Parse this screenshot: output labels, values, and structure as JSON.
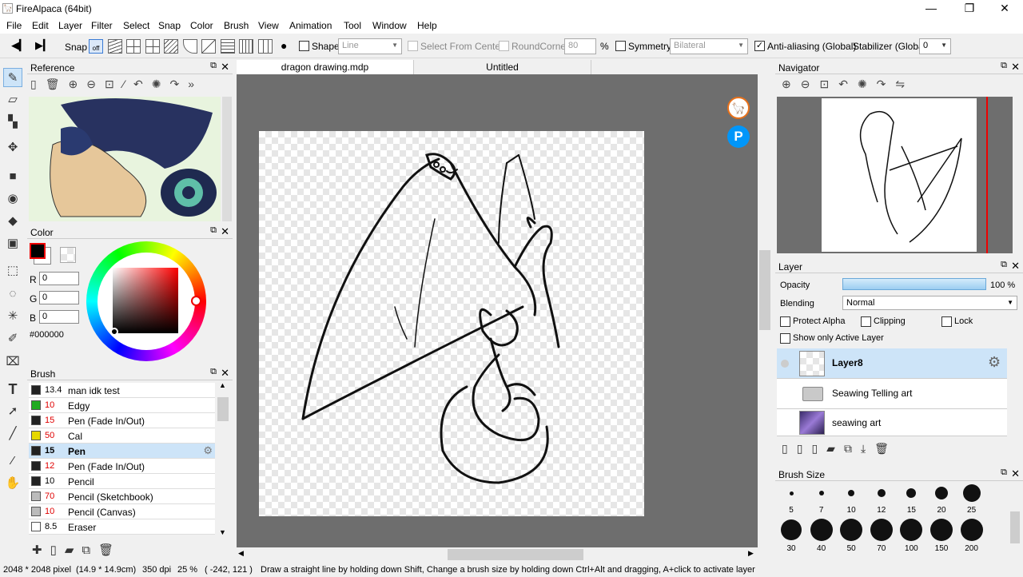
{
  "window": {
    "title": "FireAlpaca (64bit)",
    "min": "—",
    "max": "❐",
    "close": "✕"
  },
  "menu": [
    "File",
    "Edit",
    "Layer",
    "Filter",
    "Select",
    "Snap",
    "Color",
    "Brush",
    "View",
    "Animation",
    "Tool",
    "Window",
    "Help"
  ],
  "toolbar": {
    "snap_label": "Snap",
    "off_label": "off",
    "shape_label": "Shape",
    "shape_value": "Line",
    "select_from_center": "Select From Center",
    "roundcorner_label": "RoundCorner",
    "roundcorner_value": "80",
    "percent": "%",
    "symmetry_label": "Symmetry",
    "symmetry_value": "Bilateral",
    "antialias_label": "Anti-aliasing (Global)",
    "stabilizer_label": "Stabilizer (Global)",
    "stabilizer_value": "0"
  },
  "tabs": [
    {
      "label": "dragon drawing.mdp"
    },
    {
      "label": "Untitled"
    }
  ],
  "reference": {
    "title": "Reference"
  },
  "color": {
    "title": "Color",
    "r_label": "R",
    "g_label": "G",
    "b_label": "B",
    "r": "0",
    "g": "0",
    "b": "0",
    "hex": "#000000"
  },
  "brush": {
    "title": "Brush",
    "items": [
      {
        "size": "13.4",
        "name": "man idk test",
        "color": "#222222",
        "size_color": "#000"
      },
      {
        "size": "10",
        "name": "Edgy",
        "color": "#22aa22",
        "size_color": "#e00000"
      },
      {
        "size": "15",
        "name": "Pen (Fade In/Out)",
        "color": "#222222",
        "size_color": "#e00000"
      },
      {
        "size": "50",
        "name": "Cal",
        "color": "#e6d800",
        "size_color": "#e00000"
      },
      {
        "size": "15",
        "name": "Pen",
        "color": "#222222",
        "size_color": "#000"
      },
      {
        "size": "12",
        "name": "Pen (Fade In/Out)",
        "color": "#222222",
        "size_color": "#e00000"
      },
      {
        "size": "10",
        "name": "Pencil",
        "color": "#222222",
        "size_color": "#000"
      },
      {
        "size": "70",
        "name": "Pencil (Sketchbook)",
        "color": "#bbbbbb",
        "size_color": "#e00000"
      },
      {
        "size": "10",
        "name": "Pencil (Canvas)",
        "color": "#bbbbbb",
        "size_color": "#e00000"
      },
      {
        "size": "8.5",
        "name": "Eraser",
        "color": "#ffffff",
        "size_color": "#000"
      }
    ]
  },
  "navigator": {
    "title": "Navigator"
  },
  "layer": {
    "title": "Layer",
    "opacity_label": "Opacity",
    "opacity_value": "100 %",
    "opacity": 1.0,
    "blending_label": "Blending",
    "blending_value": "Normal",
    "protect_alpha": "Protect Alpha",
    "clipping": "Clipping",
    "lock": "Lock",
    "show_only": "Show only Active Layer",
    "items": [
      {
        "name": "Layer8"
      },
      {
        "name": "Seawing Telling art"
      },
      {
        "name": "seawing art"
      }
    ]
  },
  "brushsize": {
    "title": "Brush Size",
    "sizes": [
      "5",
      "7",
      "10",
      "12",
      "15",
      "20",
      "25",
      "30",
      "40",
      "50",
      "70",
      "100",
      "150",
      "200"
    ]
  },
  "status": {
    "dims": "2048 * 2048 pixel",
    "cm": "(14.9 * 14.9cm)",
    "dpi": "350 dpi",
    "zoom": "25 %",
    "coords": "( -242, 121 )",
    "hint": "Draw a straight line by holding down Shift, Change a brush size by holding down Ctrl+Alt and dragging, A+click to activate layer"
  }
}
